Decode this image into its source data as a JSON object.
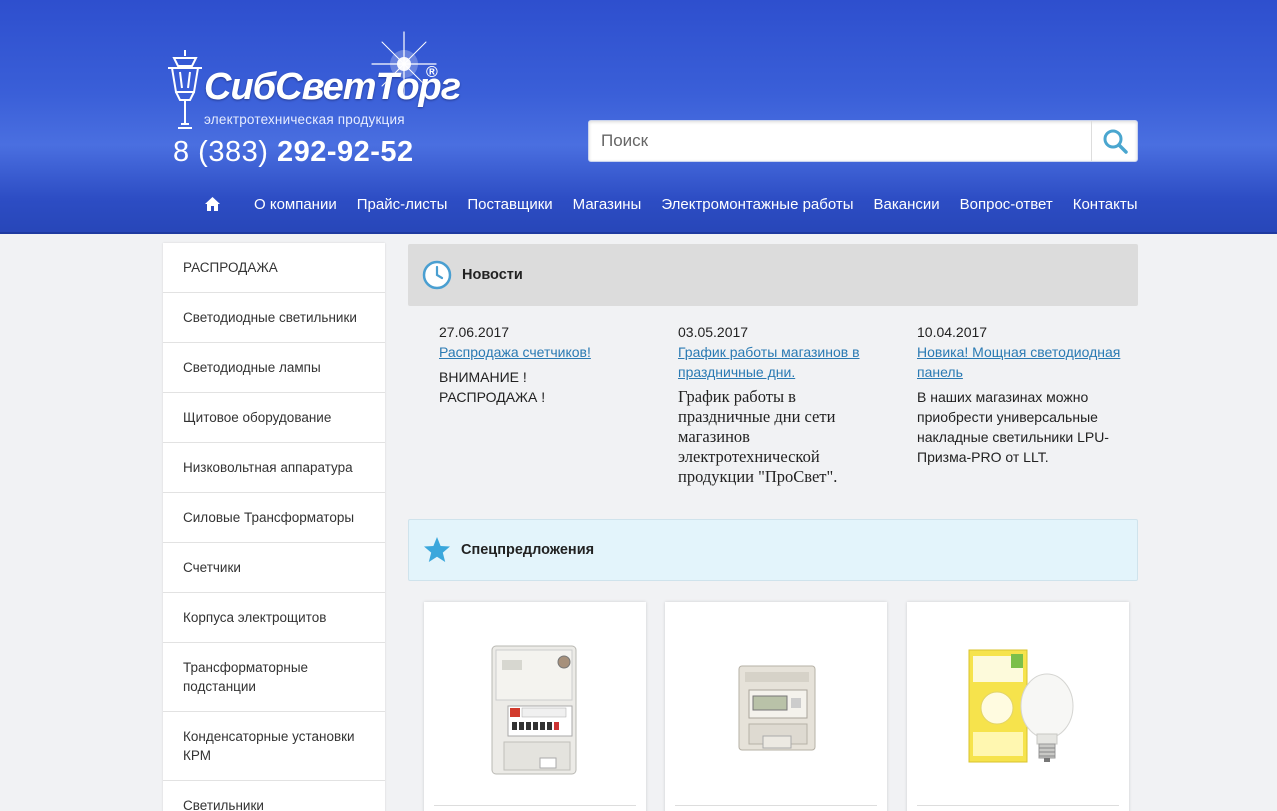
{
  "header": {
    "logo_text": "СибСветТорг",
    "logo_reg": "®",
    "logo_subtitle": "электротехническая продукция",
    "phone_prefix": "8 (383)",
    "phone_number": "292-92-52",
    "search_placeholder": "Поиск"
  },
  "nav": {
    "home_icon": "home-icon",
    "items": [
      {
        "label": "О компании"
      },
      {
        "label": "Прайс-листы"
      },
      {
        "label": "Поставщики"
      },
      {
        "label": "Магазины"
      },
      {
        "label": "Электромонтажные работы"
      },
      {
        "label": "Вакансии"
      },
      {
        "label": "Вопрос-ответ"
      },
      {
        "label": "Контакты"
      }
    ]
  },
  "sidebar": {
    "items": [
      {
        "label": "РАСПРОДАЖА"
      },
      {
        "label": "Светодиодные светильники"
      },
      {
        "label": "Светодиодные лампы"
      },
      {
        "label": "Щитовое оборудование"
      },
      {
        "label": "Низковольтная аппаратура"
      },
      {
        "label": "Силовые Трансформаторы"
      },
      {
        "label": "Счетчики"
      },
      {
        "label": "Корпуса электрощитов"
      },
      {
        "label": "Трансформаторные подстанции"
      },
      {
        "label": "Конденсаторные установки КРМ"
      },
      {
        "label": "Светильники"
      }
    ]
  },
  "news": {
    "title": "Новости",
    "icon": "clock-icon",
    "items": [
      {
        "date": "27.06.2017",
        "link": "Распродажа счетчиков!",
        "body": "ВНИМАНИЕ !\nРАСПРОДАЖА !"
      },
      {
        "date": "03.05.2017",
        "link": "График работы магазинов в праздничные дни.",
        "body": "График работы в праздничные дни сети магазинов электротехнической продукции \"ПроСвет\"."
      },
      {
        "date": "10.04.2017",
        "link": "Новика! Мощная светодиодная панель",
        "body": "В наших магазинах можно приобрести универсальные накладные светильники LPU-Призма-PRO от LLT."
      }
    ]
  },
  "special": {
    "title": "Спецпредложения",
    "icon": "star-icon",
    "products": [
      {
        "image": "electricity-meter-image"
      },
      {
        "image": "din-rail-meter-image"
      },
      {
        "image": "led-bulb-image"
      }
    ]
  },
  "colors": {
    "header_blue": "#3a5fd8",
    "link_blue": "#2a7ab3",
    "news_head_bg": "#dcdcdc",
    "special_head_bg": "#e3f4fb",
    "icon_blue": "#4a9fd1"
  }
}
